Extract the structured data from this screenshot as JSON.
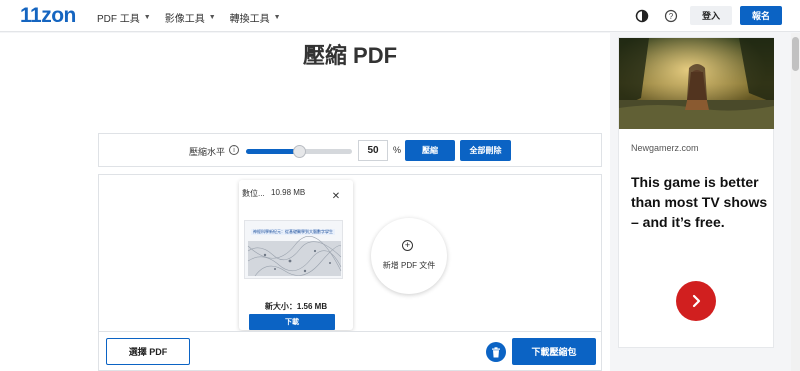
{
  "header": {
    "logo": "11zon",
    "nav": [
      {
        "label": "PDF 工具"
      },
      {
        "label": "影像工具"
      },
      {
        "label": "轉換工具"
      }
    ],
    "login_label": "登入",
    "signup_label": "報名"
  },
  "main": {
    "title": "壓縮 PDF",
    "settings": {
      "level_label": "壓縮水平",
      "level_value": "50",
      "level_fraction": 0.5,
      "percent_sign": "%",
      "compress_label": "壓縮",
      "delete_all_label": "全部刪除"
    },
    "file": {
      "name": "數位...",
      "size": "10.98 MB",
      "thumbnail_title": "神經科學新紀元：從基礎醫學到大腦數字孿生",
      "new_size": "新大小：1.56 MB",
      "download_label": "下載"
    },
    "add_label": "新增 PDF 文件",
    "choose_label": "選擇 PDF",
    "download_zip_label": "下載壓縮包"
  },
  "ad": {
    "source": "Newgamerz.com",
    "text": "This game is better than most TV shows – and it’s free."
  },
  "colors": {
    "brand_blue": "#0b63c4",
    "ad_red": "#d11f1f"
  }
}
